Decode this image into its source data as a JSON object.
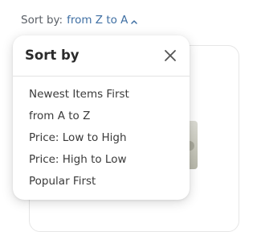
{
  "sort_trigger": {
    "label": "Sort by:",
    "value": "from Z to A",
    "icon": "chevron-up-icon"
  },
  "popover": {
    "title": "Sort by",
    "close_icon": "close-icon",
    "options": [
      {
        "label": "Newest Items First"
      },
      {
        "label": "from A to Z"
      },
      {
        "label": "Price: Low to High"
      },
      {
        "label": "Price: High to Low"
      },
      {
        "label": "Popular First"
      }
    ]
  },
  "colors": {
    "accent": "#3f6fa3",
    "text": "#3a3a3a",
    "muted": "#5a5f66"
  }
}
